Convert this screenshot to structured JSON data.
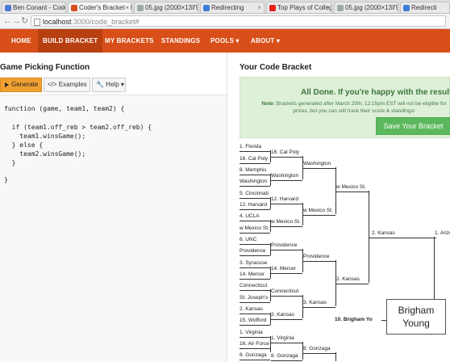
{
  "browser": {
    "tabs": [
      {
        "label": "Ben Conant - Code",
        "color": "#4a7bd0"
      },
      {
        "label": "Coder's Bracket - F",
        "color": "#d84f1a"
      },
      {
        "label": "05.jpg (2000×1379)",
        "color": "#9aa"
      },
      {
        "label": "Redirecting",
        "color": "#3b7dd8"
      },
      {
        "label": "Top Plays of College",
        "color": "#e62117"
      },
      {
        "label": "05.jpg (2000×1379)",
        "color": "#9aa"
      },
      {
        "label": "Redirecti",
        "color": "#3b7dd8"
      }
    ],
    "url_host": "localhost",
    "url_rest": ":3000/code_bracket#"
  },
  "nav": {
    "home": "HOME",
    "build": "BUILD BRACKET",
    "my": "MY BRACKETS",
    "standings": "STANDINGS",
    "pools": "POOLS ▾",
    "about": "ABOUT ▾"
  },
  "left": {
    "title": "Game Picking Function",
    "generate": "Generate",
    "examples": "</> Examples ▾",
    "help": "🔧 Help ▾",
    "code": [
      "function (game, team1, team2) {",
      "",
      "  if (team1.off_reb > team2.off_reb) {",
      "    team1.winsGame();",
      "  } else {",
      "    team2.winsGame();",
      "  }",
      "",
      "}"
    ]
  },
  "right": {
    "title": "Your Code Bracket",
    "done": "All Done. If you're happy with the results",
    "note_label": "Note:",
    "note": "Brackets generated after March 20th, 12:15pm EST will not be eligible for prizes, but you can still track their score & standings!",
    "save": "Save Your Bracket",
    "r1": [
      "1. Florida",
      "16. Cal Poly",
      "8. Memphis",
      "Washington",
      "5. Cincinnati",
      "12. Harvard",
      "4. UCLA",
      "w Mexico St.",
      "6. UNC",
      "Providence",
      "3. Syracuse",
      "14. Mercer",
      "Connecticut",
      "St. Joseph's",
      "2. Kansas",
      "15. Wofford",
      "1. Virginia",
      "16. Air Force",
      "8. Gonzaga"
    ],
    "r2": [
      "16. Cal Poly",
      "Washington",
      "12. Harvard",
      "w Mexico St.",
      "Providence",
      "14. Mercer",
      "Connecticut",
      "2. Kansas",
      "1. Virginia",
      "8. Gonzaga"
    ],
    "r3": [
      "Washington",
      "w Mexico St.",
      "Providence",
      "3. Kansas",
      "8. Gonzaga"
    ],
    "r4": [
      "w Mexico St.",
      "2. Kansas"
    ],
    "r5": [
      "2. Kansas"
    ],
    "r6": [
      "1. Arizo"
    ],
    "highlight": "10. Brigham Yo",
    "byu_line1": "Brigham",
    "byu_line2": "Young"
  }
}
